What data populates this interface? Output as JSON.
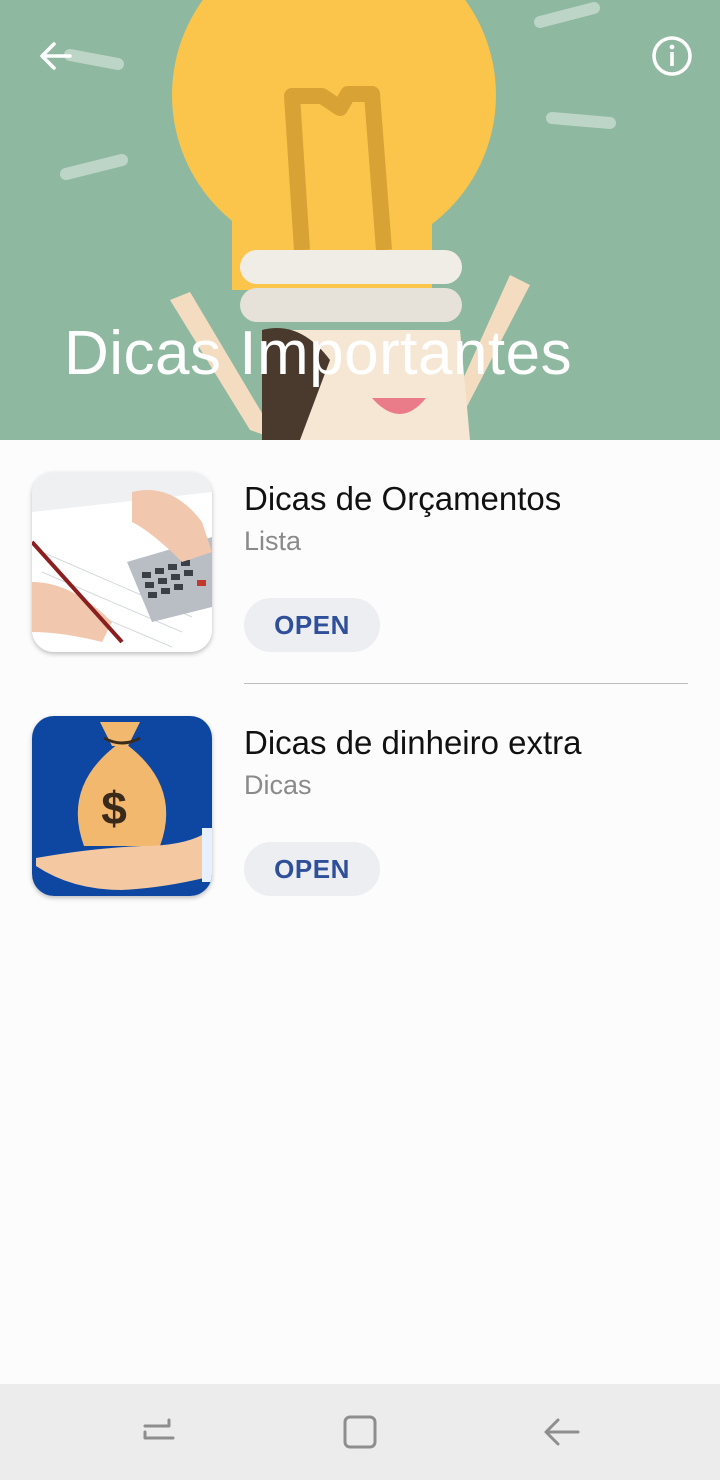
{
  "header": {
    "title": "Dicas Importantes",
    "background_color": "#8fb8a0",
    "icons": {
      "back": "arrow-left-icon",
      "info": "info-icon"
    }
  },
  "items": [
    {
      "title": "Dicas de Orçamentos",
      "subtitle": "Lista",
      "button_label": "OPEN",
      "image": "calculator-and-pen-photo"
    },
    {
      "title": "Dicas de dinheiro extra",
      "subtitle": "Dicas",
      "button_label": "OPEN",
      "image": "money-bag-on-hand-icon"
    }
  ],
  "navbar": {
    "icons": [
      "recent-apps-icon",
      "home-icon",
      "back-icon"
    ],
    "background_color": "#ececec"
  },
  "colors": {
    "button_text": "#2f4f9a",
    "button_bg": "#eceef1",
    "thumb2_bg": "#0d47a1"
  }
}
